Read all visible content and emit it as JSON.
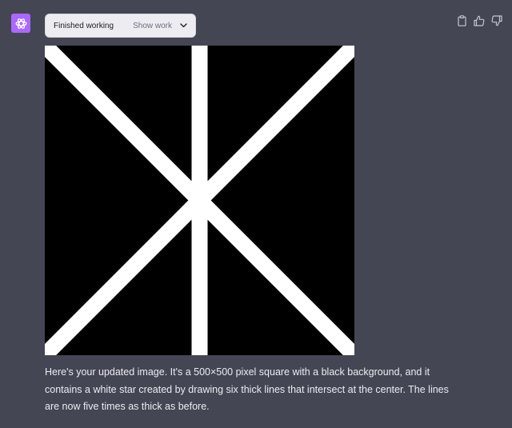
{
  "assistant": {
    "avatar_icon": "openai-logo-icon",
    "avatar_color": "#ab68ff"
  },
  "status_pill": {
    "label": "Finished working",
    "toggle_label": "Show work",
    "toggle_icon": "chevron-down-icon"
  },
  "actions": [
    {
      "icon": "clipboard-icon"
    },
    {
      "icon": "thumbs-up-icon"
    },
    {
      "icon": "thumbs-down-icon"
    }
  ],
  "image": {
    "background_color": "#000000",
    "line_color": "#ffffff",
    "line_count": 6
  },
  "message": {
    "text": "Here's your updated image. It's a 500×500 pixel square with a black background, and it contains a white star created by drawing six thick lines that intersect at the center. The lines are now five times as thick as before."
  }
}
